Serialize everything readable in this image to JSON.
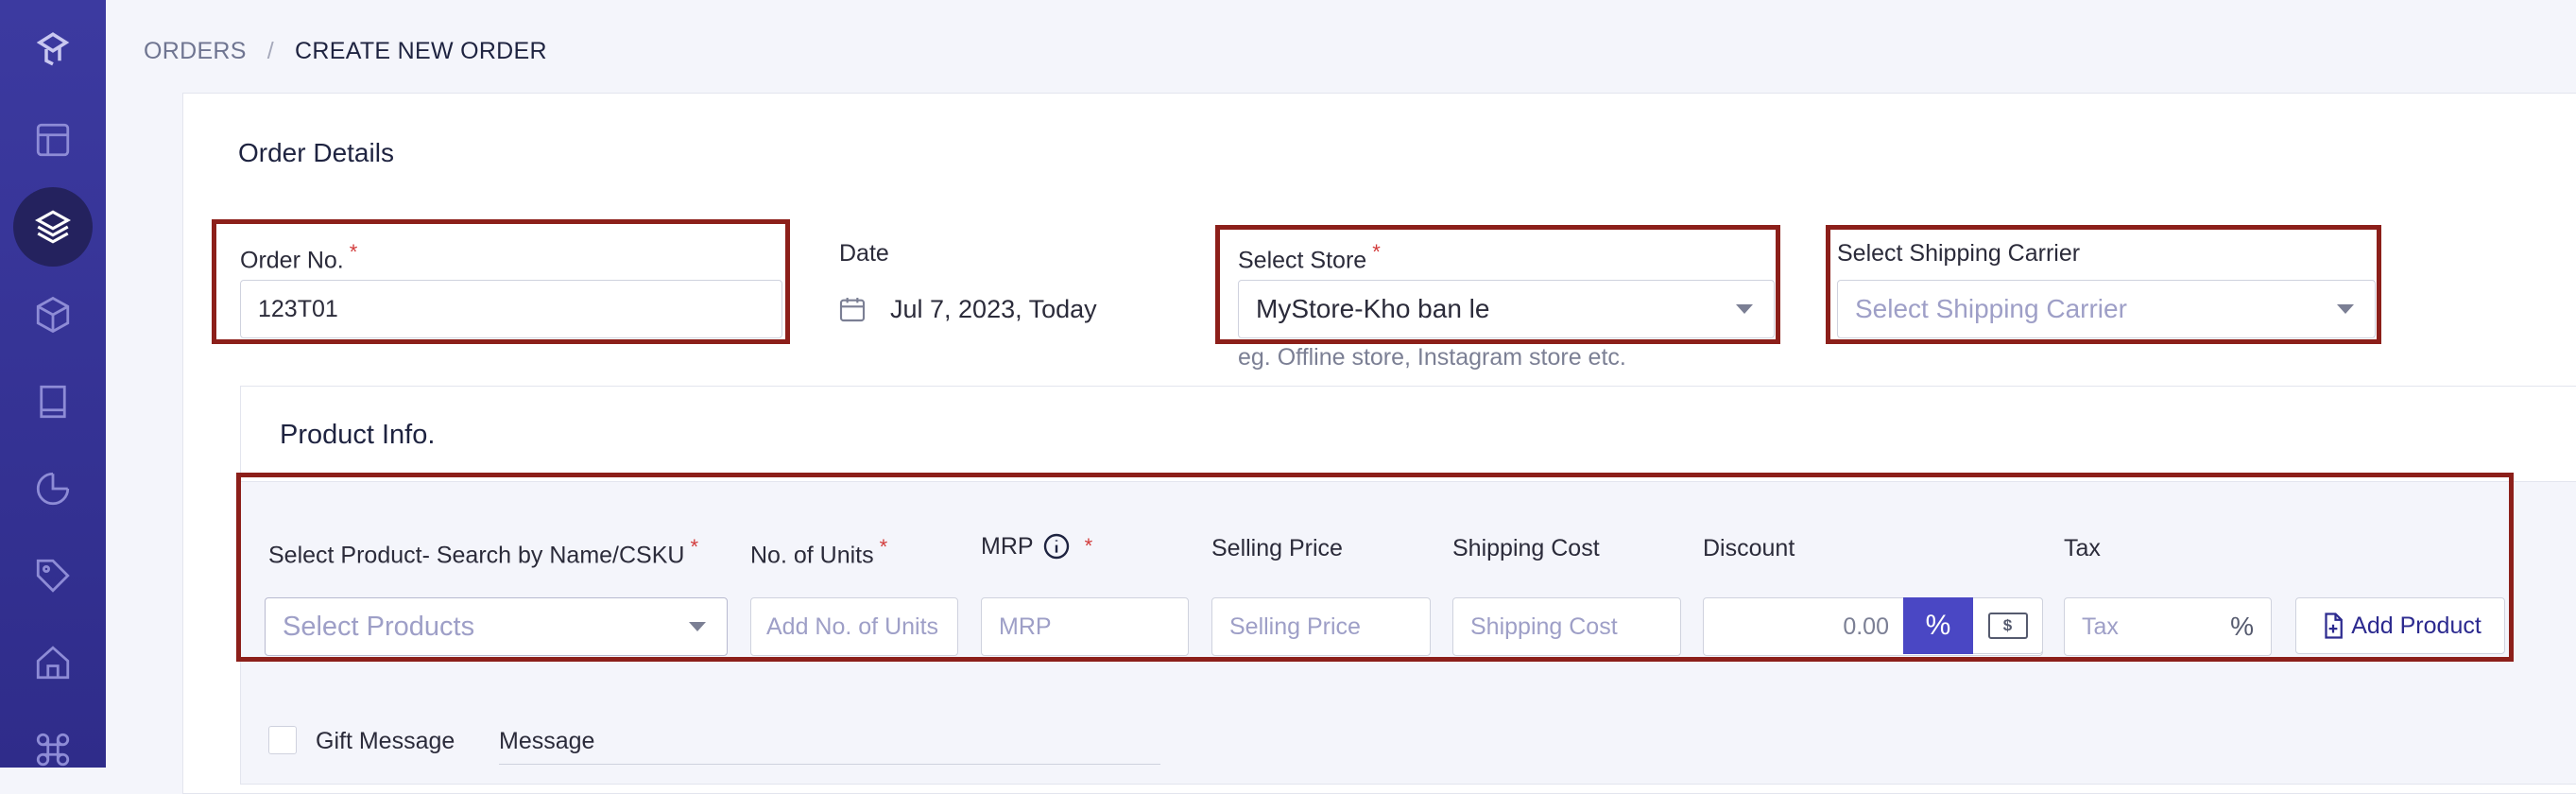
{
  "breadcrumb": {
    "parent": "ORDERS",
    "separator": "/",
    "current": "CREATE NEW ORDER"
  },
  "sidebar": {
    "items": [
      {
        "icon": "logo-icon"
      },
      {
        "icon": "layout-icon"
      },
      {
        "icon": "layers-icon",
        "active": true
      },
      {
        "icon": "box-icon"
      },
      {
        "icon": "book-icon"
      },
      {
        "icon": "pie-chart-icon"
      },
      {
        "icon": "tag-icon"
      },
      {
        "icon": "home-icon"
      },
      {
        "icon": "command-icon"
      }
    ]
  },
  "order_details": {
    "title": "Order Details",
    "order_no": {
      "label": "Order No.",
      "value": "123T01"
    },
    "date": {
      "label": "Date",
      "value": "Jul 7, 2023, Today"
    },
    "store": {
      "label": "Select Store",
      "value": "MyStore-Kho ban le",
      "hint": "eg. Offline store, Instagram store etc."
    },
    "carrier": {
      "label": "Select Shipping Carrier",
      "placeholder": "Select Shipping Carrier"
    }
  },
  "product_info": {
    "title": "Product Info.",
    "product": {
      "label": "Select Product- Search by Name/CSKU",
      "placeholder": "Select Products"
    },
    "units": {
      "label": "No. of Units",
      "placeholder": "Add No. of Units"
    },
    "mrp": {
      "label": "MRP",
      "placeholder": "MRP"
    },
    "selling_price": {
      "label": "Selling Price",
      "placeholder": "Selling Price"
    },
    "shipping_cost": {
      "label": "Shipping Cost",
      "placeholder": "Shipping Cost"
    },
    "discount": {
      "label": "Discount",
      "value": "0.00",
      "percent_symbol": "%",
      "currency_symbol": "$"
    },
    "tax": {
      "label": "Tax",
      "placeholder": "Tax",
      "percent_symbol": "%"
    },
    "add_button": "Add Product"
  },
  "gift": {
    "checkbox_label": "Gift Message",
    "message_label": "Message"
  },
  "required_mark": "*",
  "colors": {
    "sidebar": "#34329a",
    "accent": "#4a47c4",
    "highlight": "#8c1f1a",
    "required": "#d23b3b"
  }
}
